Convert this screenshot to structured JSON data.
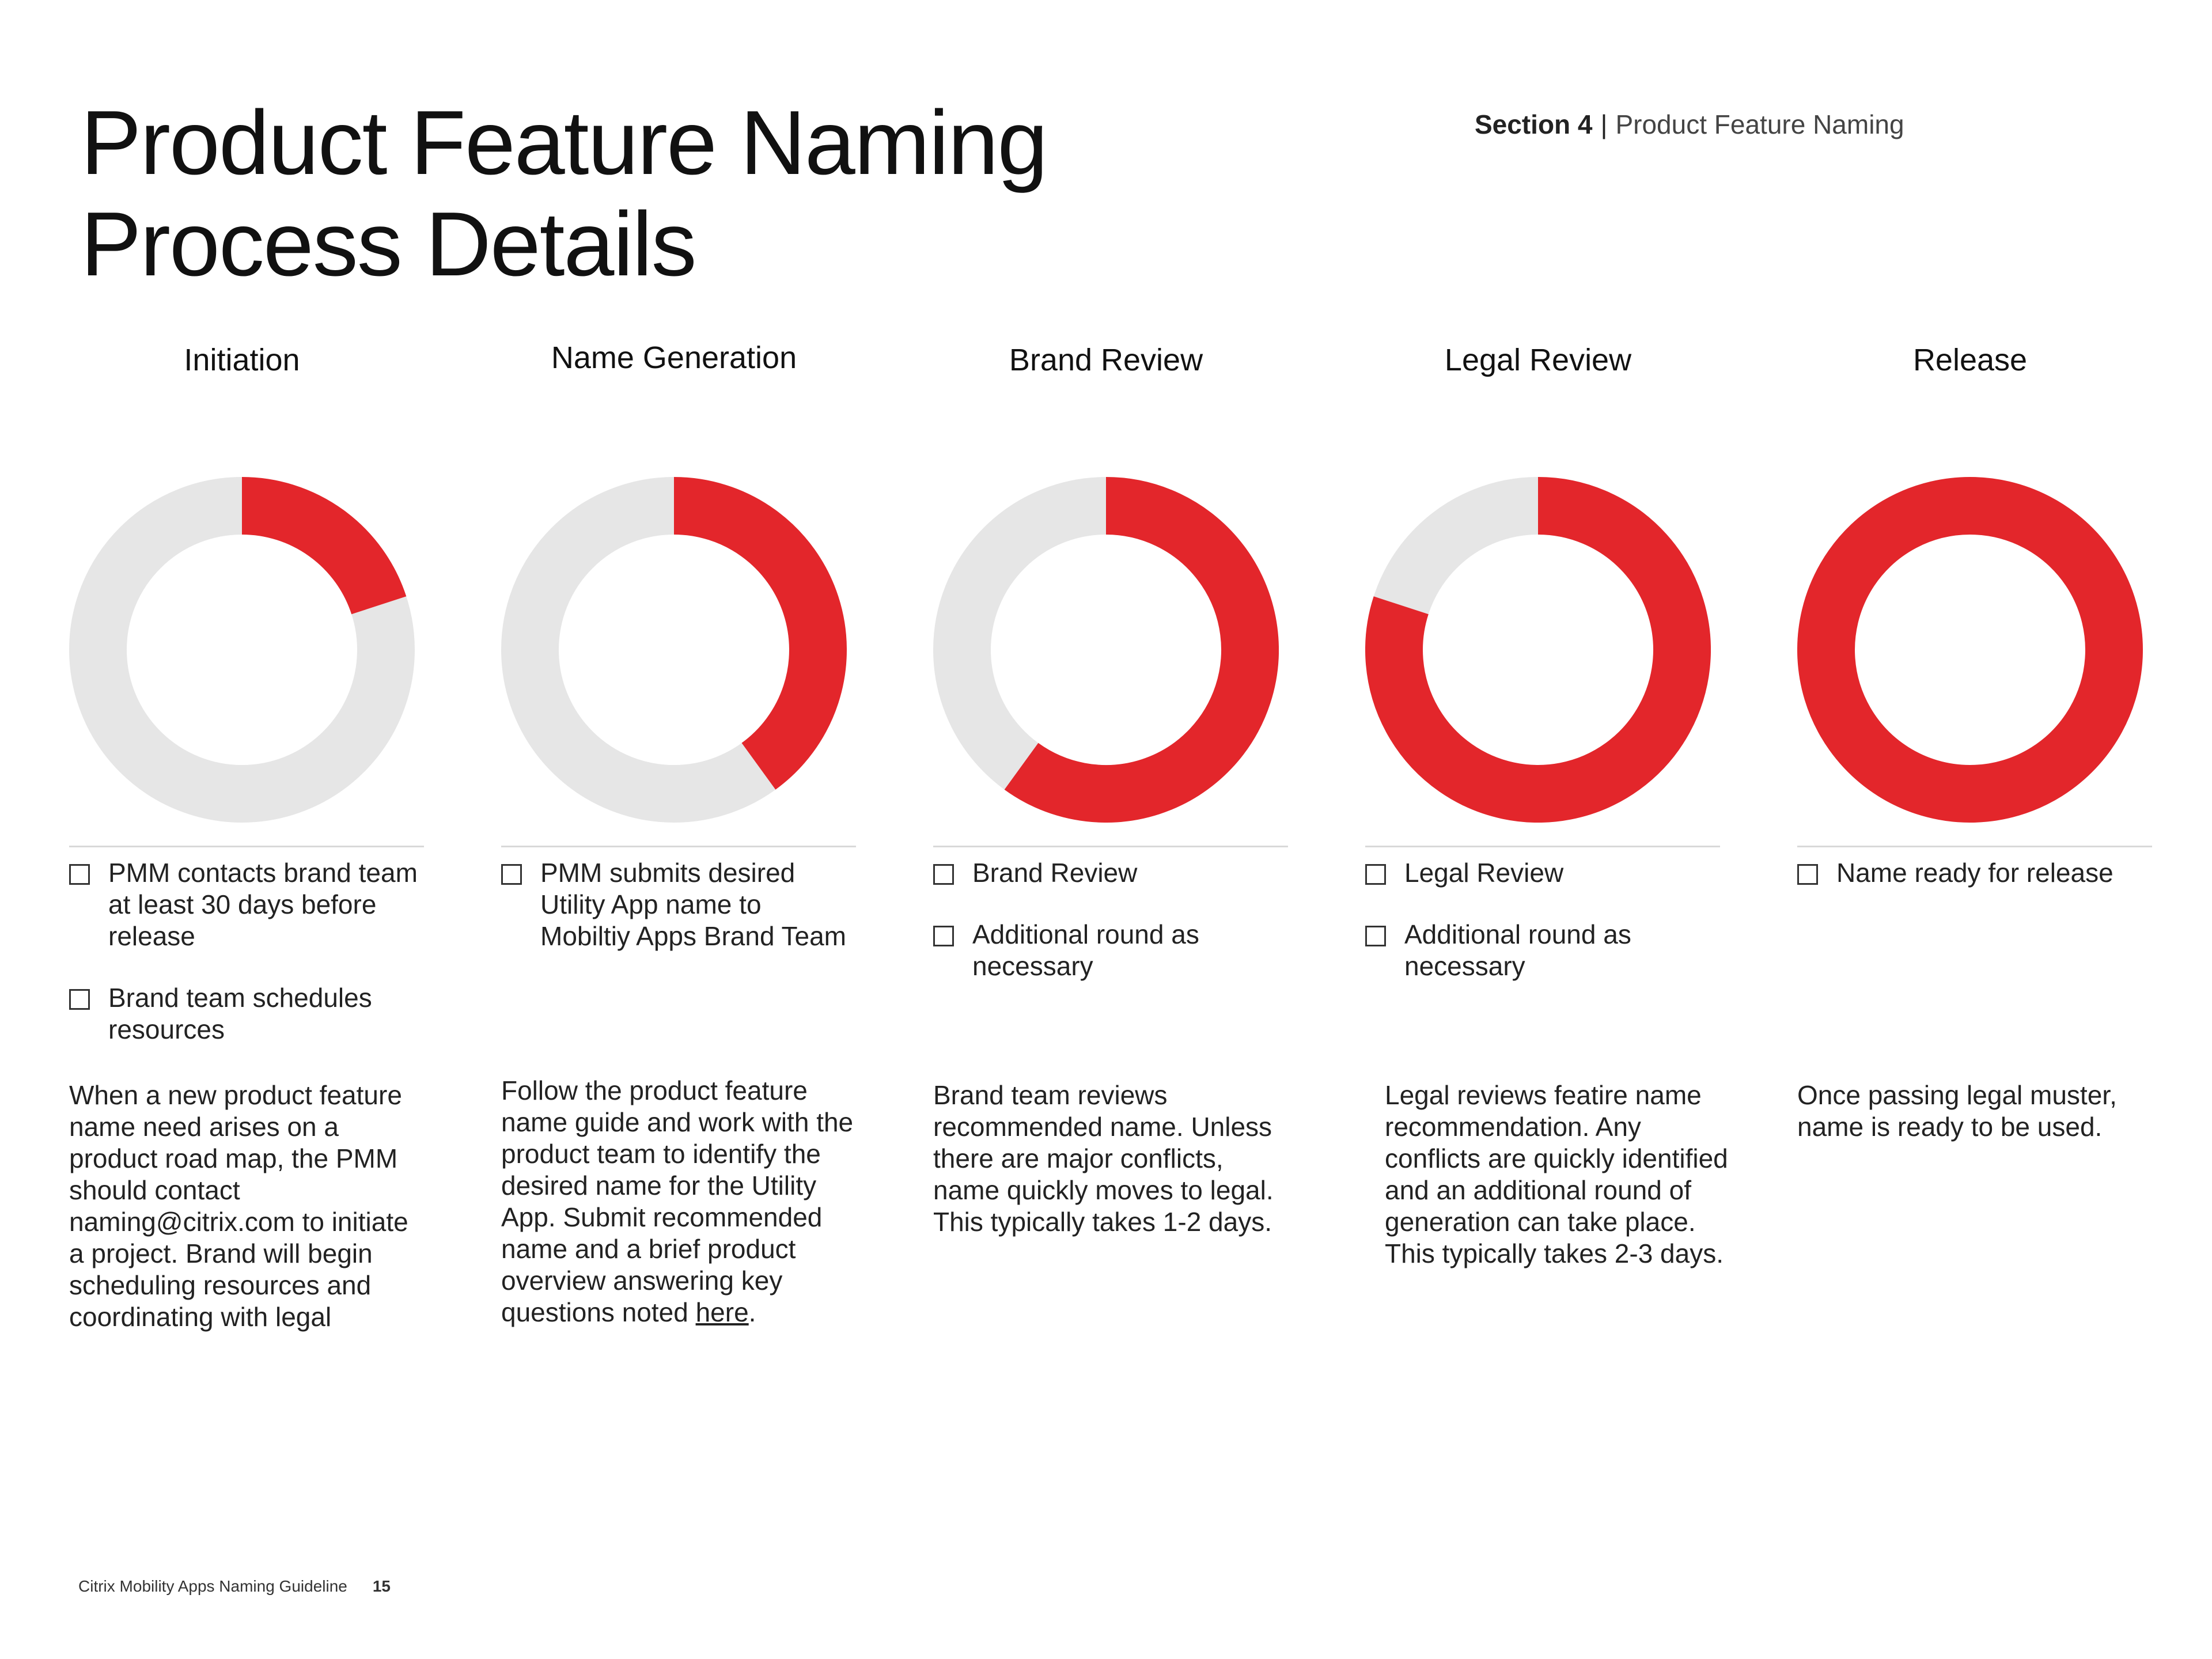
{
  "header": {
    "title_lines": [
      "Product Feature Naming",
      "Process Details"
    ],
    "section_label": "Section 4",
    "separator": "|",
    "section_name": "Product Feature Naming"
  },
  "colors": {
    "accent": "#e3262b",
    "track": "#e6e6e6"
  },
  "stages": [
    {
      "title": "Initiation",
      "progress": 0.2,
      "tasks": [
        "PMM contacts brand team at least 30 days before release",
        "Brand team schedules resources"
      ],
      "description": "When a new product feature name need arises on a product road map, the PMM should contact naming@citrix.com to initiate a project. Brand will begin scheduling resources and coordinating with legal"
    },
    {
      "title": "Name Generation",
      "progress": 0.4,
      "tasks": [
        "PMM submits desired Utility App name to Mobiltiy Apps Brand Team"
      ],
      "description": "Follow the product feature name guide and work with the product team to identify the desired name for the Utility App. Submit recommended name and a brief product overview answering key questions noted ",
      "description_link": "here",
      "description_end": "."
    },
    {
      "title": "Brand Review",
      "progress": 0.6,
      "tasks": [
        "Brand Review",
        "Additional round as necessary"
      ],
      "description": "Brand team reviews recommended name. Unless there are major conflicts, name quickly moves to legal. This typically takes 1-2 days."
    },
    {
      "title": "Legal Review",
      "progress": 0.8,
      "tasks": [
        "Legal Review",
        "Additional round as necessary"
      ],
      "description": "Legal reviews featire name recommendation. Any conflicts are quickly identified and an additional round of generation can take place. This typically takes 2-3 days."
    },
    {
      "title": "Release",
      "progress": 1.0,
      "tasks": [
        "Name ready for release"
      ],
      "description": "Once passing legal muster, name is ready to be used."
    }
  ],
  "footer": {
    "document_title": "Citrix Mobility Apps Naming Guideline",
    "page_number": "15"
  }
}
